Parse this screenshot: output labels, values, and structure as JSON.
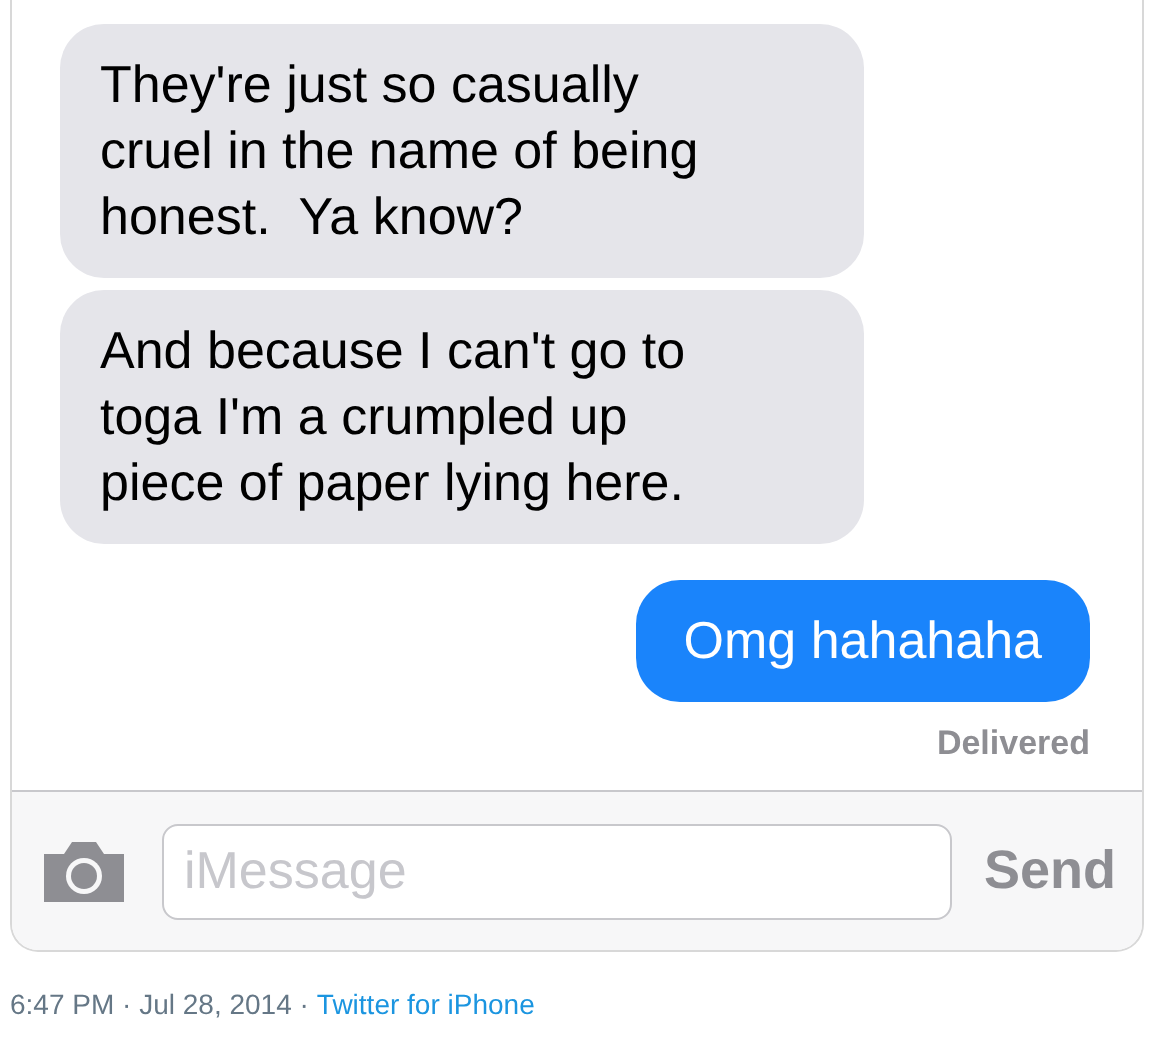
{
  "messages": [
    {
      "kind": "received",
      "text": "They're just so casually cruel in the name of being honest.  Ya know?"
    },
    {
      "kind": "received",
      "text": "And because I can't go to toga I'm a crumpled up piece of paper lying here."
    },
    {
      "kind": "sent",
      "text": "Omg hahahaha"
    }
  ],
  "status": "Delivered",
  "composer": {
    "placeholder": "iMessage",
    "send": "Send"
  },
  "footer": {
    "timestamp": "6:47 PM · Jul 28, 2014 ·",
    "source": "Twitter for iPhone"
  }
}
